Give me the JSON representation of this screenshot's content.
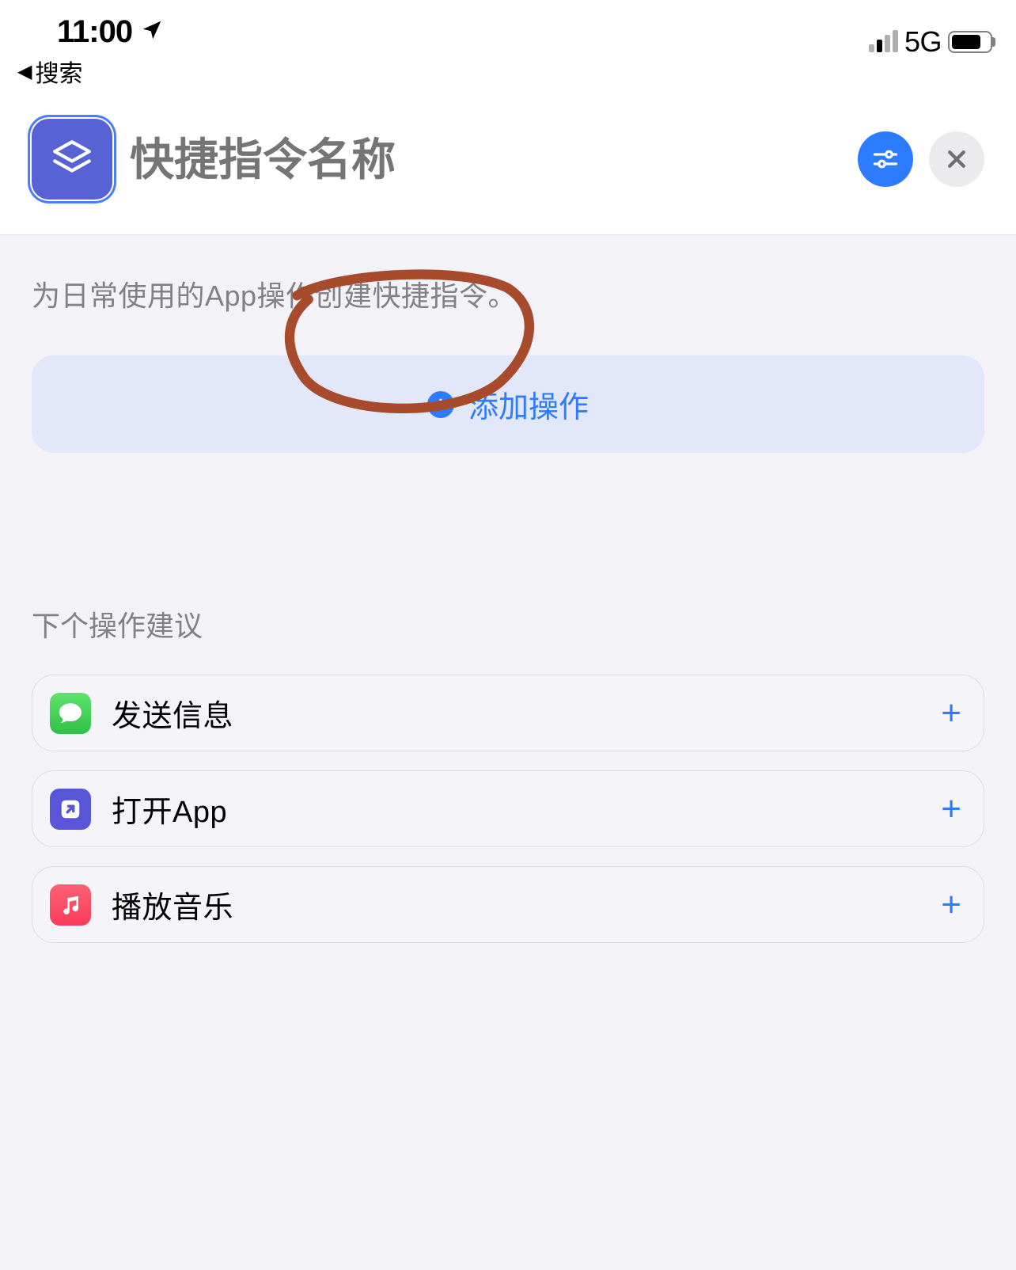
{
  "status": {
    "time": "11:00",
    "network": "5G"
  },
  "back": {
    "label": "搜索"
  },
  "header": {
    "title_placeholder": "快捷指令名称"
  },
  "main": {
    "instruction": "为日常使用的App操作创建快捷指令。",
    "add_action_label": "添加操作"
  },
  "suggestions": {
    "title": "下个操作建议",
    "items": [
      {
        "label": "发送信息",
        "icon": "messages"
      },
      {
        "label": "打开App",
        "icon": "openapp"
      },
      {
        "label": "播放音乐",
        "icon": "music"
      }
    ]
  }
}
